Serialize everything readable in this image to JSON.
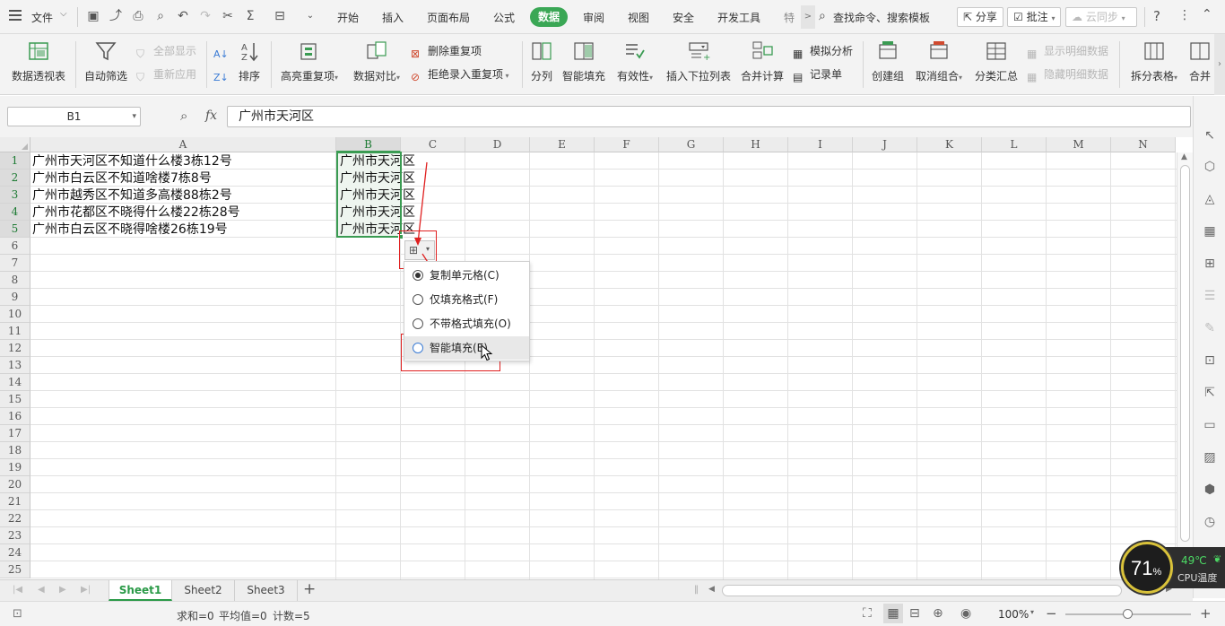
{
  "menubar": {
    "file_label": "文件",
    "tabs": [
      {
        "label": "开始"
      },
      {
        "label": "插入"
      },
      {
        "label": "页面布局"
      },
      {
        "label": "公式"
      },
      {
        "label": "数据"
      },
      {
        "label": "审阅"
      },
      {
        "label": "视图"
      },
      {
        "label": "安全"
      },
      {
        "label": "开发工具"
      },
      {
        "label": "特"
      }
    ],
    "active_tab": "数据",
    "search_label": "查找命令、搜索模板",
    "share_label": "分享",
    "comment_label": "批注",
    "sync_label": "云同步",
    "help_label": "?"
  },
  "ribbon": {
    "pivot": "数据透视表",
    "autofilter": "自动筛选",
    "show_all": "全部显示",
    "reapply": "重新应用",
    "sort": "排序",
    "highlight_dup": "高亮重复项",
    "data_compare": "数据对比",
    "remove_dup": "删除重复项",
    "reject_dup": "拒绝录入重复项",
    "split_col": "分列",
    "flash_fill": "智能填充",
    "validity": "有效性",
    "insert_dropdown": "插入下拉列表",
    "consolidate": "合并计算",
    "what_if": "模拟分析",
    "record_form": "记录单",
    "create_group": "创建组",
    "ungroup": "取消组合",
    "subtotal": "分类汇总",
    "show_detail": "显示明细数据",
    "hide_detail": "隐藏明细数据",
    "split_table": "拆分表格",
    "merge": "合并"
  },
  "formula_bar": {
    "name_box": "B1",
    "fx_label": "fx",
    "formula": "广州市天河区"
  },
  "sheet": {
    "columns": [
      "A",
      "B",
      "C",
      "D",
      "E",
      "F",
      "G",
      "H",
      "I",
      "J",
      "K",
      "L",
      "M",
      "N"
    ],
    "rows": [
      "1",
      "2",
      "3",
      "4",
      "5",
      "6",
      "7",
      "8",
      "9",
      "10",
      "11",
      "12",
      "13",
      "14",
      "15",
      "16",
      "17",
      "18",
      "19",
      "20",
      "21",
      "22",
      "23",
      "24",
      "25"
    ],
    "col_a": [
      "广州市天河区不知道什么楼3栋12号",
      "广州市白云区不知道啥楼7栋8号",
      "广州市越秀区不知道多高楼88栋2号",
      "广州市花都区不晓得什么楼22栋28号",
      "广州市白云区不晓得啥楼26栋19号"
    ],
    "col_b": [
      "广州市天河区",
      "广州市天河区",
      "广州市天河区",
      "广州市天河区",
      "广州市天河区"
    ]
  },
  "autofill_popup": {
    "options": [
      {
        "label": "复制单元格(C)",
        "selected": true
      },
      {
        "label": "仅填充格式(F)",
        "selected": false
      },
      {
        "label": "不带格式填充(O)",
        "selected": false
      },
      {
        "label": "智能填充(E)",
        "selected": false
      }
    ]
  },
  "sheet_tabs": {
    "tabs": [
      {
        "label": "Sheet1"
      },
      {
        "label": "Sheet2"
      },
      {
        "label": "Sheet3"
      }
    ],
    "add_label": "+"
  },
  "statusbar": {
    "sum": "求和=0",
    "average": "平均值=0",
    "count": "计数=5",
    "zoom": "100%"
  },
  "cpu_widget": {
    "percent": "71",
    "percent_sign": "%",
    "temperature": "49℃",
    "caption": "CPU温度"
  },
  "colors": {
    "accent_green": "#3aa755",
    "annotation_red": "#e02020",
    "selection_green": "#3a9b52"
  }
}
